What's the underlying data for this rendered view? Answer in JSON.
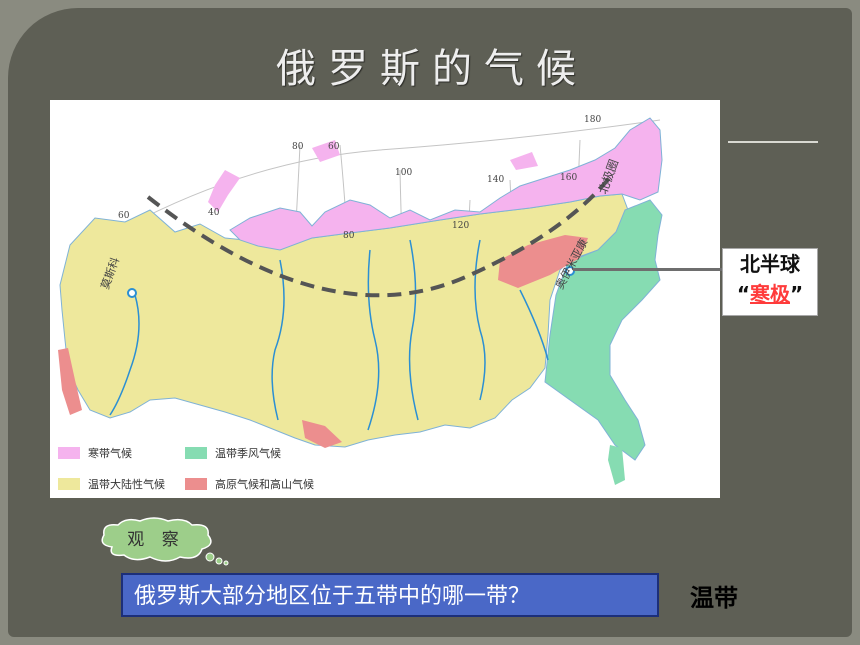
{
  "slide": {
    "title": "俄罗斯的气候"
  },
  "map": {
    "city_moscow": "莫斯科",
    "city_oymyakon": "奥伊米亚康",
    "arctic_circle_label": "北极圈",
    "longitudes": [
      "40",
      "60",
      "80",
      "100",
      "120",
      "140",
      "160",
      "180"
    ],
    "lat_80": "80",
    "lat_60": "60",
    "legend": [
      {
        "label": "寒带气候",
        "color": "#f5b3ee"
      },
      {
        "label": "温带季风气候",
        "color": "#86dcb2"
      },
      {
        "label": "温带大陆性气候",
        "color": "#eee89c"
      },
      {
        "label": "高原气候和高山气候",
        "color": "#ec8e8e"
      }
    ],
    "colors": {
      "ocean": "#ffffff",
      "river": "#2b8fd3",
      "circle": "#555555"
    }
  },
  "callout": {
    "line1": "北半球",
    "quote_open": "“",
    "highlight": "寒极",
    "quote_close": "”"
  },
  "thought_bubble": {
    "label": "观 察",
    "color": "#9dce8a"
  },
  "question": {
    "text": "俄罗斯大部分地区位于五带中的哪一带？",
    "answer": "温带"
  }
}
